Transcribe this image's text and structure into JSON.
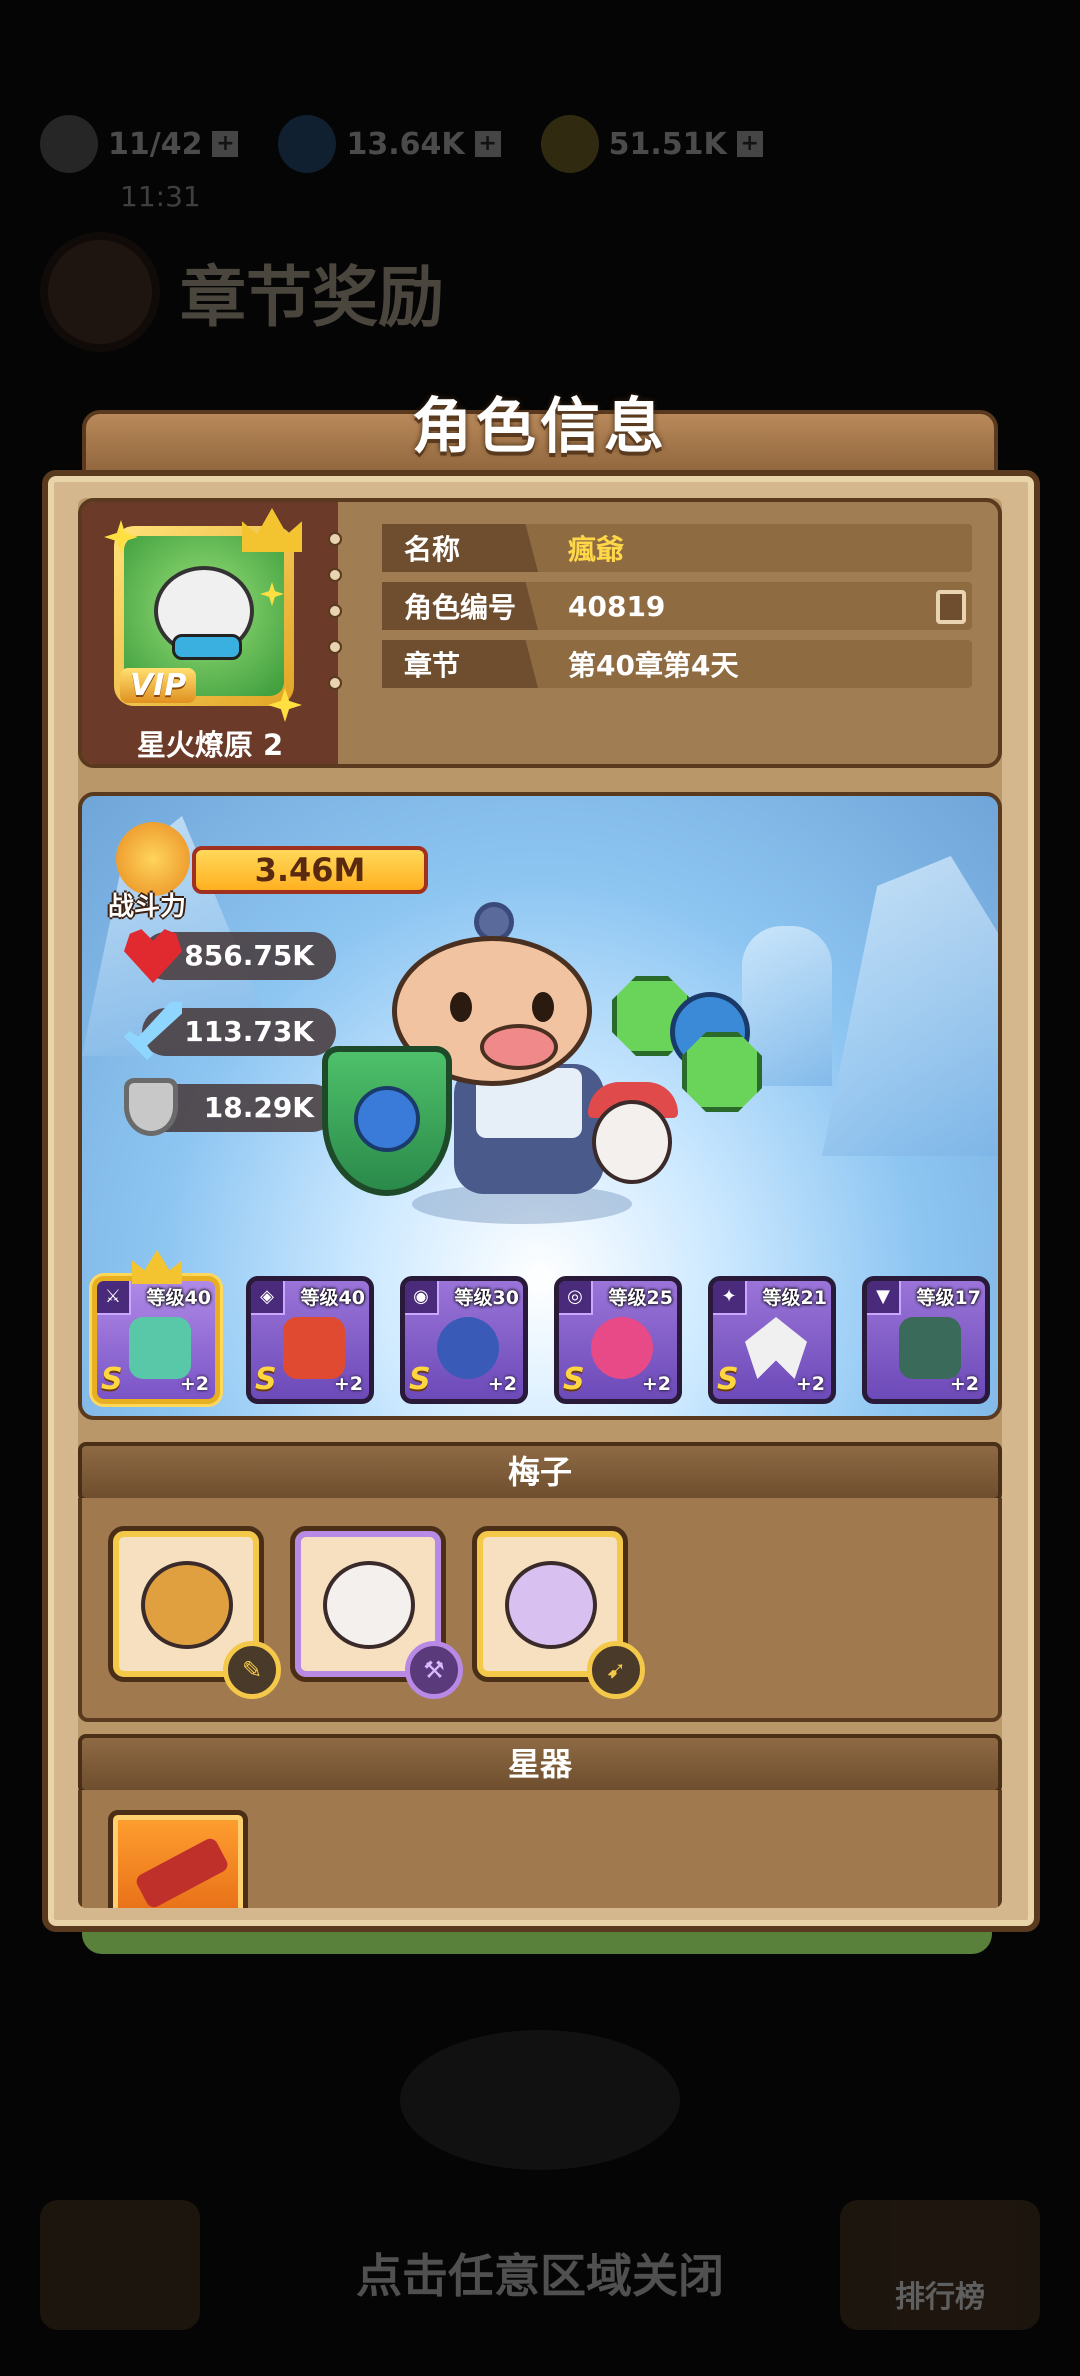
{
  "background": {
    "resources": [
      {
        "icon": "stamina-icon",
        "value": "11/42"
      },
      {
        "icon": "gem-icon",
        "value": "13.64K"
      },
      {
        "icon": "coin-icon",
        "value": "51.51K"
      }
    ],
    "time": "11:31",
    "chapter_reward_title": "章节奖励",
    "close_hint": "点击任意区域关闭",
    "leaderboard_label": "排行榜"
  },
  "dialog": {
    "title": "角色信息",
    "profile": {
      "vip_label": "VIP",
      "vip_title": "星火燎原 2",
      "rows": [
        {
          "label": "名称",
          "value": "瘋爺"
        },
        {
          "label": "角色编号",
          "value": "40819"
        },
        {
          "label": "章节",
          "value": "第40章第4天"
        }
      ]
    },
    "stats": {
      "power_label": "战斗力",
      "power": "3.46M",
      "hp": "856.75K",
      "attack": "113.73K",
      "defense": "18.29K"
    },
    "equipment": [
      {
        "level": "等级40",
        "grade": "S",
        "plus": "+2",
        "type": "⚔",
        "color": "#58c8a8"
      },
      {
        "level": "等级40",
        "grade": "S",
        "plus": "+2",
        "type": "◈",
        "color": "#e04a30"
      },
      {
        "level": "等级30",
        "grade": "S",
        "plus": "+2",
        "type": "◉",
        "color": "#3a5ab8"
      },
      {
        "level": "等级25",
        "grade": "S",
        "plus": "+2",
        "type": "◎",
        "color": "#e84a88"
      },
      {
        "level": "等级21",
        "grade": "S",
        "plus": "+2",
        "type": "✦",
        "color": "#f0f0f0"
      },
      {
        "level": "等级17",
        "grade": "",
        "plus": "+2",
        "type": "▼",
        "color": "#3a6a5a"
      }
    ],
    "pets_section_title": "梅子",
    "pets": [
      {
        "face_color": "#e0a040",
        "type_glyph": "✎",
        "frame": "gold"
      },
      {
        "face_color": "#f4f0ee",
        "type_glyph": "⚒",
        "frame": "purple"
      },
      {
        "face_color": "#d8c0f0",
        "type_glyph": "➹",
        "frame": "gold"
      }
    ],
    "star_section_title": "星器"
  }
}
